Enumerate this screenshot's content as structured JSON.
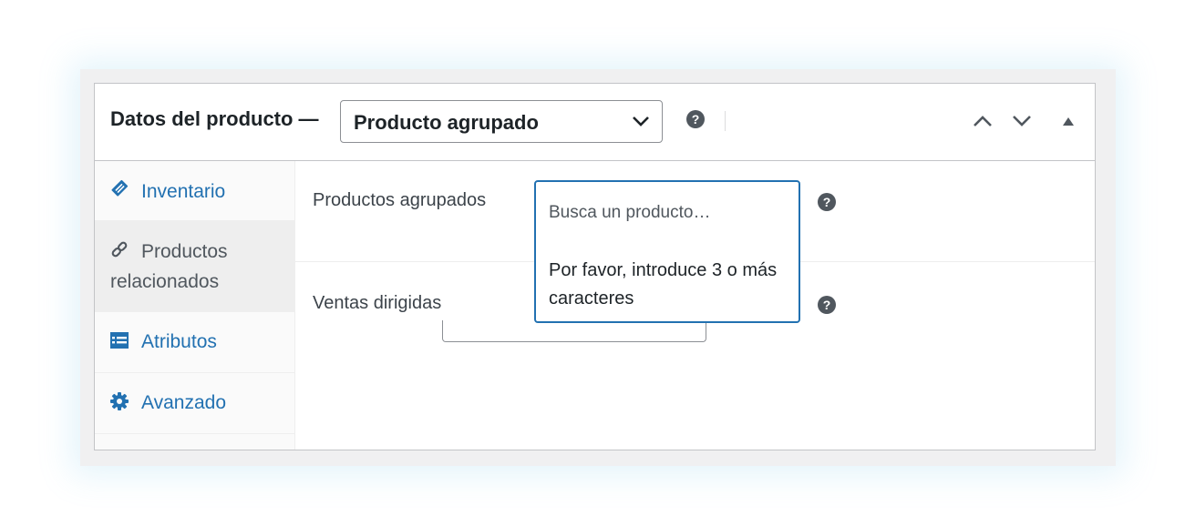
{
  "header": {
    "title": "Datos del producto —",
    "product_type": "Producto agrupado"
  },
  "tabs": [
    {
      "label": "Inventario",
      "icon": "tag-icon"
    },
    {
      "label_line1": "Productos",
      "label_line2": "relacionados",
      "icon": "link-icon"
    },
    {
      "label": "Atributos",
      "icon": "table-icon"
    },
    {
      "label": "Avanzado",
      "icon": "gear-icon"
    }
  ],
  "fields": {
    "grouped_products_label": "Productos agrupados",
    "upsells_label": "Ventas dirigidas"
  },
  "dropdown": {
    "search_placeholder": "Busca un producto…",
    "message": "Por favor, introduce 3 o más caracteres"
  },
  "colors": {
    "accent": "#2271b1",
    "link": "#2271b1",
    "text": "#1d2327",
    "border": "#c3c4c7"
  }
}
